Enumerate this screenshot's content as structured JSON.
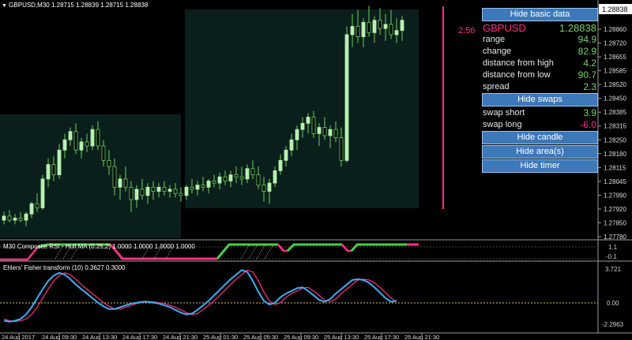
{
  "window": {
    "chart_title": "GBPUSD,M30  1.28715 1.28839 1.28715 1.28838",
    "dropdown_glyph": "▼"
  },
  "main_chart": {
    "current_price": "1.28838",
    "timer": "2:56",
    "price_labels": [
      "1.28860",
      "1.28720",
      "1.28655",
      "1.28585",
      "1.28520",
      "1.28450",
      "1.28385",
      "1.28315",
      "1.28250",
      "1.28180",
      "1.28115",
      "1.28045",
      "1.27990",
      "1.27920",
      "1.27850",
      "1.27780"
    ],
    "candles": [
      [
        1.2786,
        1.279,
        1.2784,
        1.2788
      ],
      [
        1.2788,
        1.2791,
        1.2785,
        1.2786
      ],
      [
        1.2786,
        1.2789,
        1.2784,
        1.2787
      ],
      [
        1.2787,
        1.279,
        1.2785,
        1.2786
      ],
      [
        1.2786,
        1.279,
        1.2783,
        1.2789
      ],
      [
        1.2789,
        1.2795,
        1.2787,
        1.2794
      ],
      [
        1.2794,
        1.2799,
        1.279,
        1.2792
      ],
      [
        1.2792,
        1.2808,
        1.2791,
        1.2806
      ],
      [
        1.2806,
        1.2816,
        1.2802,
        1.2813
      ],
      [
        1.2813,
        1.2817,
        1.2805,
        1.2808
      ],
      [
        1.2808,
        1.2823,
        1.2806,
        1.282
      ],
      [
        1.282,
        1.2828,
        1.2816,
        1.2825
      ],
      [
        1.2825,
        1.2831,
        1.2822,
        1.2829
      ],
      [
        1.2829,
        1.2833,
        1.2818,
        1.282
      ],
      [
        1.282,
        1.2826,
        1.2816,
        1.2824
      ],
      [
        1.2824,
        1.2828,
        1.2819,
        1.2822
      ],
      [
        1.2822,
        1.2832,
        1.282,
        1.283
      ],
      [
        1.283,
        1.2834,
        1.282,
        1.2822
      ],
      [
        1.2822,
        1.2825,
        1.2812,
        1.2815
      ],
      [
        1.2815,
        1.282,
        1.2808,
        1.2812
      ],
      [
        1.2812,
        1.2816,
        1.2798,
        1.2802
      ],
      [
        1.2802,
        1.2808,
        1.2796,
        1.2806
      ],
      [
        1.2806,
        1.2812,
        1.28,
        1.2802
      ],
      [
        1.2802,
        1.2805,
        1.279,
        1.2796
      ],
      [
        1.2796,
        1.2803,
        1.2792,
        1.2801
      ],
      [
        1.2801,
        1.2806,
        1.2796,
        1.2798
      ],
      [
        1.2798,
        1.2804,
        1.2794,
        1.2802
      ],
      [
        1.2802,
        1.2805,
        1.2796,
        1.28
      ],
      [
        1.28,
        1.2804,
        1.2797,
        1.2802
      ],
      [
        1.2802,
        1.2805,
        1.2798,
        1.28
      ],
      [
        1.28,
        1.2803,
        1.2797,
        1.2801
      ],
      [
        1.2801,
        1.2804,
        1.2797,
        1.2799
      ],
      [
        1.2799,
        1.2802,
        1.2795,
        1.2798
      ],
      [
        1.2798,
        1.2803,
        1.2796,
        1.2802
      ],
      [
        1.2802,
        1.2806,
        1.2799,
        1.2801
      ],
      [
        1.2801,
        1.2805,
        1.2798,
        1.2803
      ],
      [
        1.2803,
        1.2807,
        1.28,
        1.2802
      ],
      [
        1.2802,
        1.2806,
        1.2799,
        1.2805
      ],
      [
        1.2805,
        1.2808,
        1.2802,
        1.2804
      ],
      [
        1.2804,
        1.2809,
        1.2801,
        1.2807
      ],
      [
        1.2807,
        1.281,
        1.2803,
        1.2805
      ],
      [
        1.2805,
        1.281,
        1.2802,
        1.2808
      ],
      [
        1.2808,
        1.2812,
        1.2804,
        1.2807
      ],
      [
        1.2807,
        1.2812,
        1.2803,
        1.2806
      ],
      [
        1.2806,
        1.2813,
        1.2804,
        1.2811
      ],
      [
        1.2811,
        1.2815,
        1.2806,
        1.2808
      ],
      [
        1.2808,
        1.2812,
        1.2801,
        1.2803
      ],
      [
        1.2803,
        1.2807,
        1.2795,
        1.28
      ],
      [
        1.28,
        1.2806,
        1.2794,
        1.2804
      ],
      [
        1.2804,
        1.2812,
        1.2802,
        1.281
      ],
      [
        1.281,
        1.2818,
        1.2808,
        1.2815
      ],
      [
        1.2815,
        1.2822,
        1.2812,
        1.282
      ],
      [
        1.282,
        1.2828,
        1.2817,
        1.2825
      ],
      [
        1.2825,
        1.2832,
        1.282,
        1.283
      ],
      [
        1.283,
        1.2836,
        1.2826,
        1.2833
      ],
      [
        1.2833,
        1.2838,
        1.2828,
        1.2836
      ],
      [
        1.2836,
        1.2839,
        1.2826,
        1.2828
      ],
      [
        1.2828,
        1.2833,
        1.2822,
        1.2831
      ],
      [
        1.2831,
        1.2836,
        1.2825,
        1.2827
      ],
      [
        1.2827,
        1.2832,
        1.2821,
        1.283
      ],
      [
        1.283,
        1.2834,
        1.2824,
        1.2826
      ],
      [
        1.2826,
        1.2831,
        1.2812,
        1.2815
      ],
      [
        1.2815,
        1.288,
        1.2814,
        1.2876
      ],
      [
        1.2876,
        1.2886,
        1.287,
        1.288
      ],
      [
        1.288,
        1.2888,
        1.2872,
        1.2875
      ],
      [
        1.2875,
        1.2884,
        1.287,
        1.2882
      ],
      [
        1.2882,
        1.289,
        1.2875,
        1.2877
      ],
      [
        1.2877,
        1.2885,
        1.2872,
        1.2883
      ],
      [
        1.2883,
        1.2889,
        1.2876,
        1.2879
      ],
      [
        1.2879,
        1.2886,
        1.2873,
        1.2881
      ],
      [
        1.2881,
        1.2888,
        1.2874,
        1.2876
      ],
      [
        1.2876,
        1.2884,
        1.2872,
        1.2878
      ],
      [
        1.2878,
        1.2885,
        1.2873,
        1.2883
      ]
    ]
  },
  "info_panel": {
    "hide_basic_data_label": "Hide basic data",
    "symbol": "GBPUSD",
    "symbol_price": "1.28838",
    "rows": [
      {
        "label": "range",
        "value": "94.9"
      },
      {
        "label": "change",
        "value": "82.9"
      },
      {
        "label": "distance from high",
        "value": "4.2"
      },
      {
        "label": "distance from low",
        "value": "90.7"
      },
      {
        "label": "spread",
        "value": "2.3"
      }
    ],
    "hide_swaps_label": "Hide swaps",
    "swap_short_label": "swap short",
    "swap_short_value": "3.9",
    "swap_long_label": "swap long",
    "swap_long_value": "-6.0",
    "hide_candle_label": "Hide candle",
    "hide_areas_label": "Hide area(s)",
    "hide_timer_label": "Hide timer"
  },
  "indicator1": {
    "title": "M30 Composite RSI - Hull MA (0.25,2) 1.0000 1.0000 1.0000 1.0000",
    "levels": [
      "1.1",
      "-0.1"
    ]
  },
  "indicator2": {
    "title": "Ehlers' Fisher transform (10) 0.3627 0.3000",
    "levels": [
      "3.721",
      "0.00",
      "-2.2963"
    ],
    "fisher": [
      -2.0,
      -2.1,
      -2.0,
      -1.8,
      -1.3,
      -0.5,
      0.5,
      1.5,
      2.4,
      3.0,
      3.3,
      3.1,
      2.6,
      2.0,
      1.5,
      1.0,
      0.5,
      0.0,
      -0.4,
      -0.7,
      -0.7,
      -0.5,
      -0.3,
      -0.1,
      0.0,
      0.1,
      0.1,
      0.0,
      -0.1,
      -0.3,
      -0.5,
      -0.8,
      -1.1,
      -1.3,
      -1.2,
      -0.8,
      -0.3,
      0.2,
      0.8,
      1.4,
      2.0,
      2.6,
      3.1,
      3.6,
      3.4,
      2.4,
      1.2,
      0.2,
      -0.2,
      0.0,
      0.6,
      1.0,
      1.3,
      1.6,
      1.7,
      1.3,
      0.8,
      0.3,
      0.1,
      0.4,
      1.0,
      1.5,
      2.0,
      2.5,
      2.6,
      2.5,
      2.2,
      1.7,
      1.1,
      0.5,
      0.1,
      0.2
    ],
    "signal": [
      -1.8,
      -2.0,
      -2.1,
      -2.0,
      -1.8,
      -1.3,
      -0.5,
      0.5,
      1.5,
      2.4,
      3.0,
      3.3,
      3.1,
      2.6,
      2.0,
      1.5,
      1.0,
      0.5,
      0.0,
      -0.4,
      -0.7,
      -0.7,
      -0.5,
      -0.3,
      -0.1,
      0.0,
      0.1,
      0.1,
      0.0,
      -0.1,
      -0.3,
      -0.5,
      -0.8,
      -1.1,
      -1.3,
      -1.2,
      -0.8,
      -0.3,
      0.2,
      0.8,
      1.4,
      2.0,
      2.6,
      3.1,
      3.6,
      3.4,
      2.4,
      1.2,
      0.2,
      -0.2,
      0.0,
      0.6,
      1.0,
      1.3,
      1.6,
      1.7,
      1.3,
      0.8,
      0.3,
      0.1,
      0.4,
      1.0,
      1.5,
      2.0,
      2.5,
      2.6,
      2.5,
      2.2,
      1.7,
      1.1,
      0.5,
      0.1
    ]
  },
  "time_axis": {
    "labels": [
      "24 Aug 2017",
      "24 Aug 09:30",
      "24 Aug 13:30",
      "24 Aug 17:30",
      "24 Aug 21:30",
      "25 Aug 01:30",
      "25 Aug 05:30",
      "25 Aug 09:30",
      "25 Aug 13:30",
      "25 Aug 17:30",
      "25 Aug 21:30"
    ]
  },
  "colors": {
    "bull_candle": "#b8f0b0",
    "candle_wick": "#6ccf5a",
    "area_fill": "#0a1f1c",
    "separator": "#9a9a9a",
    "timer_line": "#ff2f86",
    "price_tag": "#ffffff",
    "fisher": "#3ab0f0",
    "signal": "#ff2f86",
    "zero_line": "#d6c24e",
    "hull_up": "#46d046",
    "hull_down": "#ff2f86"
  }
}
